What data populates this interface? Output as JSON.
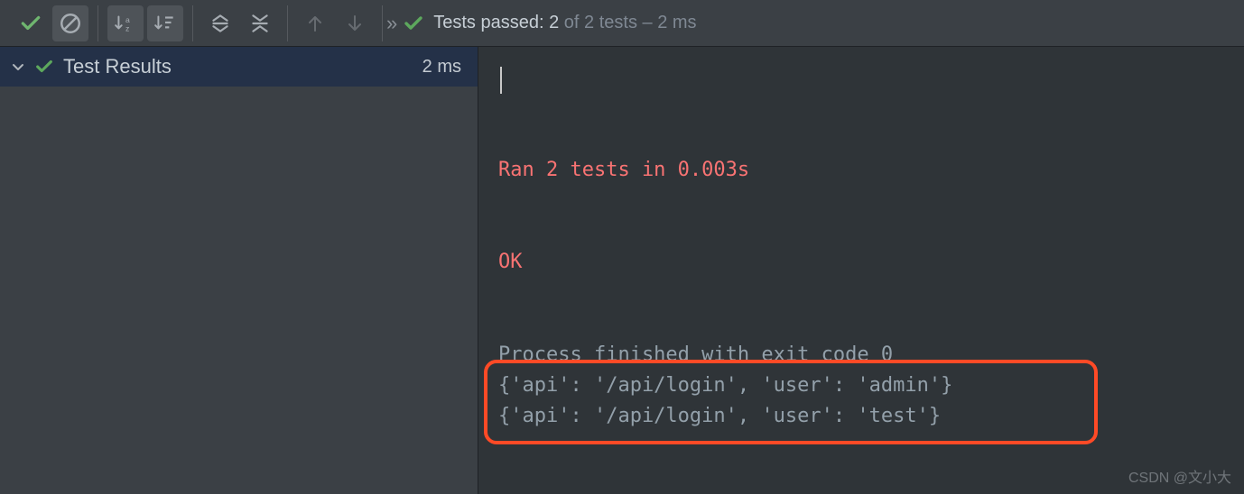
{
  "toolbar": {
    "status_prefix": "Tests passed:",
    "status_count": "2",
    "status_total": "of 2 tests",
    "status_duration": "– 2 ms"
  },
  "tree": {
    "root_label": "Test Results",
    "root_duration": "2 ms"
  },
  "console": {
    "ran_line": "Ran 2 tests in 0.003s",
    "ok_line": "OK",
    "proc_line": "Process finished with exit code 0",
    "out1": "{'api': '/api/login', 'user': 'admin'}",
    "out2": "{'api': '/api/login', 'user': 'test'}"
  },
  "watermark": "CSDN @文小大"
}
